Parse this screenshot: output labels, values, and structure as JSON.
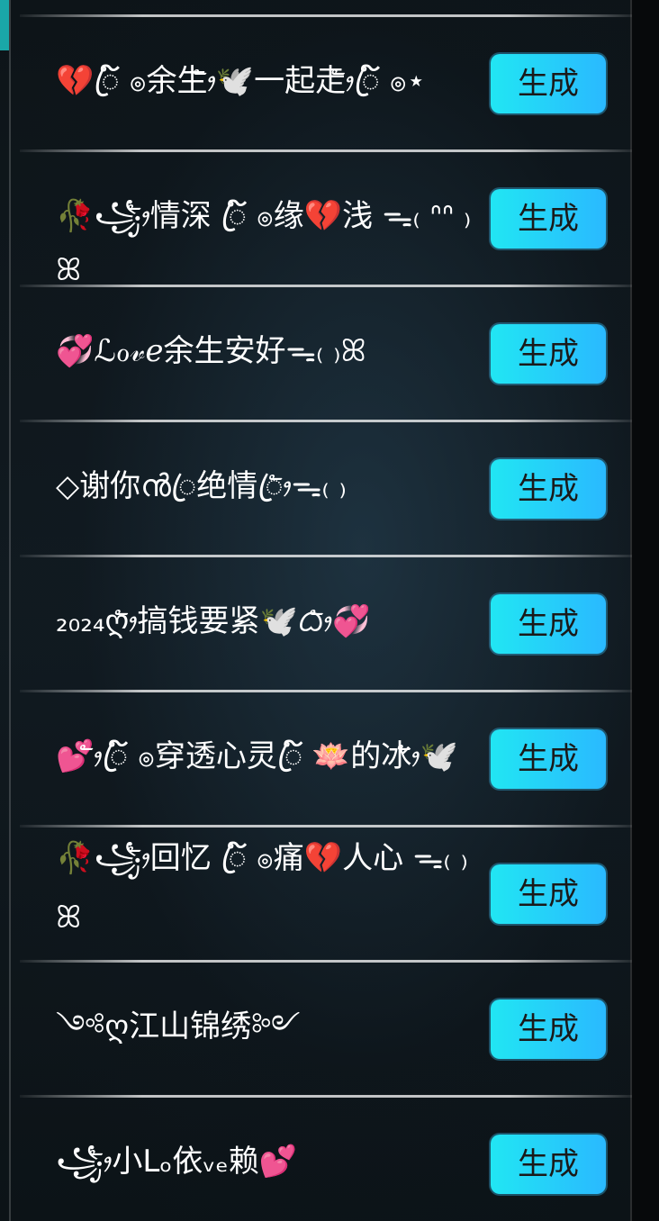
{
  "button_label": "生成",
  "colors": {
    "button_gradient_start": "#21e6f3",
    "button_gradient_end": "#2ab9ff",
    "text": "#ffffff"
  },
  "items": [
    {
      "text": "💔ꦿ໌ ၜ余生ᤥ🕊️一起走ᤥꦿ໌ ၜ⋆"
    },
    {
      "text": "🥀꧁ᤥ情深 ꦿ໌ ၜ缘💔浅 ᯓ₍ ᐢᐢ ₎ꕤ"
    },
    {
      "text": "💞ℒℴ𝓋ℯ余生安好ᯓ₍ ₎ꕤ"
    },
    {
      "text": "◇谢你ൻꦿ绝情ꦿᤥᯓ₍ ₎"
    },
    {
      "text": "₂₀₂₄ღᤥ搞钱要紧🕊️ᜊᤥ💞"
    },
    {
      "text": "💕ᤥꦿ໌ ၜ穿透心灵ꦿ໌ 🪷的冰ᤥ🕊️"
    },
    {
      "text": "🥀꧁ᤥ回忆 ꦿ໌ ၜ痛💔人心 ᯓ₍ ₎ꕤ"
    },
    {
      "text": "༺ღ江山锦绣༻"
    },
    {
      "text": "꧁ᤥ小Lₒ依ᵥₑ赖💕"
    }
  ]
}
